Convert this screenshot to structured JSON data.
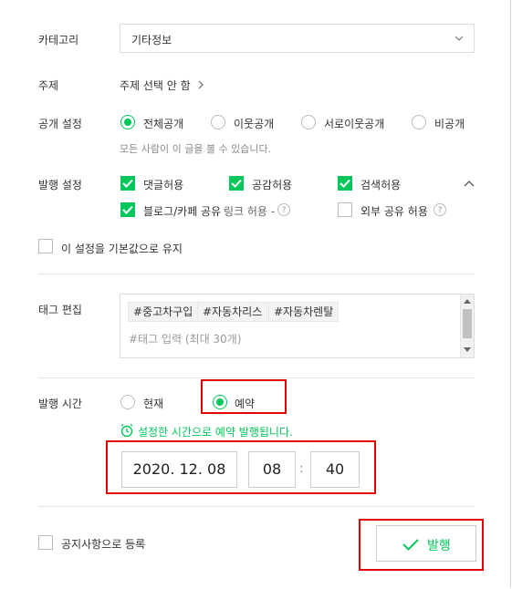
{
  "category": {
    "label": "카테고리",
    "value": "기타정보"
  },
  "topic": {
    "label": "주제",
    "value": "주제 선택 안 함"
  },
  "visibility": {
    "label": "공개 설정",
    "options": [
      "전체공개",
      "이웃공개",
      "서로이웃공개",
      "비공개"
    ],
    "selected": "전체공개",
    "hint": "모든 사람이 이 글을 볼 수 있습니다."
  },
  "publish_settings": {
    "label": "발행 설정",
    "options": [
      {
        "label": "댓글허용",
        "checked": true
      },
      {
        "label": "공감허용",
        "checked": true
      },
      {
        "label": "검색허용",
        "checked": true
      },
      {
        "label": "블로그/카페 공유",
        "checked": true,
        "extra": "링크 허용"
      },
      {
        "label": "외부 공유 허용",
        "checked": false
      }
    ],
    "help_symbol": "?",
    "link_arrow": "-"
  },
  "keep_default": {
    "label": "이 설정을 기본값으로 유지",
    "checked": false
  },
  "tags": {
    "label": "태그 편집",
    "items": [
      "#중고차구입",
      "#자동차리스",
      "#자동차렌탈"
    ],
    "placeholder": "#태그 입력 (최대 30개)"
  },
  "publish_time": {
    "label": "발행 시간",
    "options": [
      "현재",
      "예약"
    ],
    "selected": "예약",
    "notice": "설정한 시간으로 예약 발행됩니다.",
    "date": "2020. 12. 08",
    "hour": "08",
    "separator": ":",
    "minute": "40"
  },
  "notice_register": {
    "label": "공지사항으로 등록",
    "checked": false
  },
  "publish_button": {
    "label": "발행"
  },
  "colors": {
    "accent": "#03c75a",
    "highlight": "#e00000"
  }
}
